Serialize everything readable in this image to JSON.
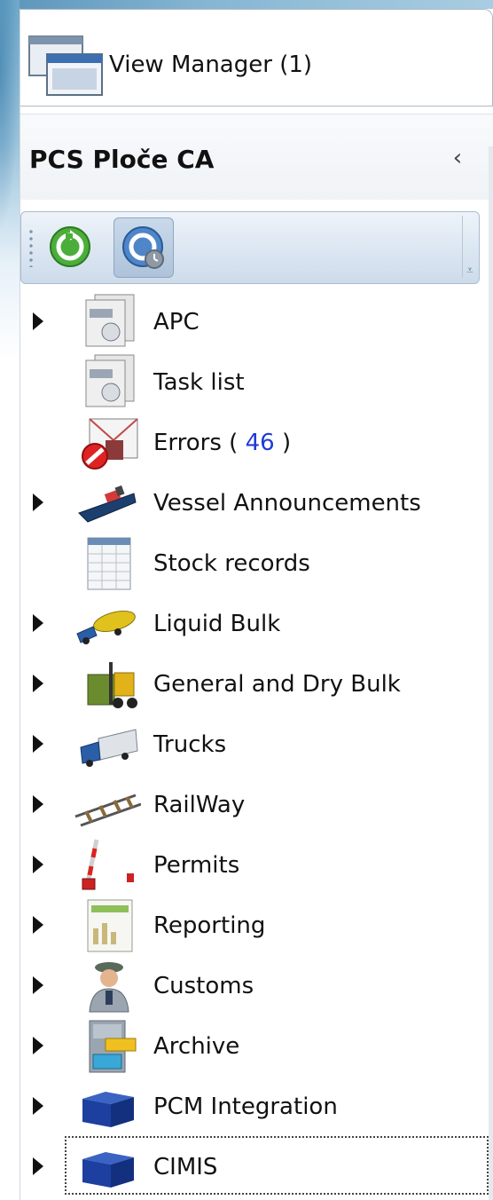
{
  "view_manager": {
    "label": "View Manager (1)",
    "icon": "window-stack-icon"
  },
  "section": {
    "title": "PCS Ploče CA",
    "collapse_glyph": "‹"
  },
  "toolbar": {
    "buttons": [
      {
        "name": "refresh-button",
        "icon": "refresh-icon"
      },
      {
        "name": "history-button",
        "icon": "history-icon"
      }
    ],
    "overflow_glyph": "⩡"
  },
  "tree": {
    "items": [
      {
        "label": "APC",
        "icon": "documents-icon",
        "expandable": true
      },
      {
        "label": "Task list",
        "icon": "documents-icon",
        "expandable": false
      },
      {
        "label": "Errors ( ",
        "count": "46",
        "suffix": " )",
        "icon": "error-mail-icon",
        "expandable": false
      },
      {
        "label": "Vessel Announcements",
        "icon": "ship-icon",
        "expandable": true
      },
      {
        "label": "Stock records",
        "icon": "spreadsheet-icon",
        "expandable": false
      },
      {
        "label": "Liquid Bulk",
        "icon": "tanker-truck-icon",
        "expandable": true
      },
      {
        "label": "General and Dry Bulk",
        "icon": "forklift-icon",
        "expandable": true
      },
      {
        "label": "Trucks",
        "icon": "truck-icon",
        "expandable": true
      },
      {
        "label": "RailWay",
        "icon": "rail-track-icon",
        "expandable": true
      },
      {
        "label": "Permits",
        "icon": "barrier-gate-icon",
        "expandable": true
      },
      {
        "label": "Reporting",
        "icon": "report-icon",
        "expandable": true
      },
      {
        "label": "Customs",
        "icon": "customs-officer-icon",
        "expandable": true
      },
      {
        "label": "Archive",
        "icon": "file-cabinet-icon",
        "expandable": true
      },
      {
        "label": "PCM Integration",
        "icon": "blue-box-icon",
        "expandable": true
      },
      {
        "label": "CIMIS",
        "icon": "blue-box-icon",
        "expandable": true
      }
    ]
  },
  "colors": {
    "count": "#1f3bd6",
    "toolbar_border": "#a9bcd1"
  }
}
